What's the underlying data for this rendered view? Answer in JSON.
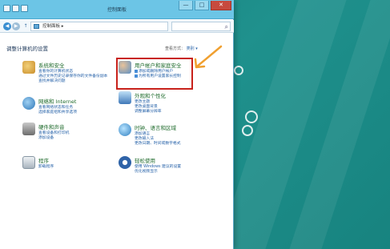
{
  "window": {
    "title": "控制面板",
    "minimize": "—",
    "maximize": "□",
    "close": "✕"
  },
  "address_bar": {
    "back_icon": "back-arrow-icon",
    "forward_icon": "forward-arrow-icon",
    "up_icon": "up-arrow-icon",
    "path": "控制面板 ▸",
    "search_placeholder": ""
  },
  "main": {
    "heading": "调整计算机的设置",
    "view_by_label": "查看方式：",
    "view_by_value": "类别 ▾"
  },
  "categories": [
    {
      "title": "系统和安全",
      "links": [
        "查看你的计算机状态",
        "通过文件历史记录保存你的文件备份副本",
        "查找并解决问题"
      ],
      "icon": "shield-icon",
      "color": "#d8a53a"
    },
    {
      "title": "网络和 Internet",
      "links": [
        "查看网络状态和任务",
        "选择家庭组和共享选项"
      ],
      "icon": "network-globe-icon",
      "color": "#3f8bc9"
    },
    {
      "title": "硬件和声音",
      "links": [
        "查看设备和打印机",
        "添加设备"
      ],
      "icon": "printer-icon",
      "color": "#7d7d7d"
    },
    {
      "title": "程序",
      "links": [
        "卸载程序"
      ],
      "icon": "programs-icon",
      "color": "#a9b4be"
    },
    {
      "title": "用户帐户和家庭安全",
      "links": [
        "添加或删除用户帐户",
        "为所有用户设置家长控制"
      ],
      "icon": "users-icon",
      "color": "#5b8fc4"
    },
    {
      "title": "外观和个性化",
      "links": [
        "更改主题",
        "更改桌面背景",
        "调整屏幕分辨率"
      ],
      "icon": "display-icon",
      "color": "#4a86c0"
    },
    {
      "title": "时钟、语言和区域",
      "links": [
        "添加语言",
        "更改输入法",
        "更改日期、时间或数字格式"
      ],
      "icon": "clock-globe-icon",
      "color": "#3b8ac8"
    },
    {
      "title": "轻松使用",
      "links": [
        "使用 Windows 建议的设置",
        "优化视频显示"
      ],
      "icon": "ease-of-access-icon",
      "color": "#2f63a8"
    }
  ],
  "annotation": {
    "highlight_color": "#c8221b",
    "arrow_color": "#f0a030"
  }
}
